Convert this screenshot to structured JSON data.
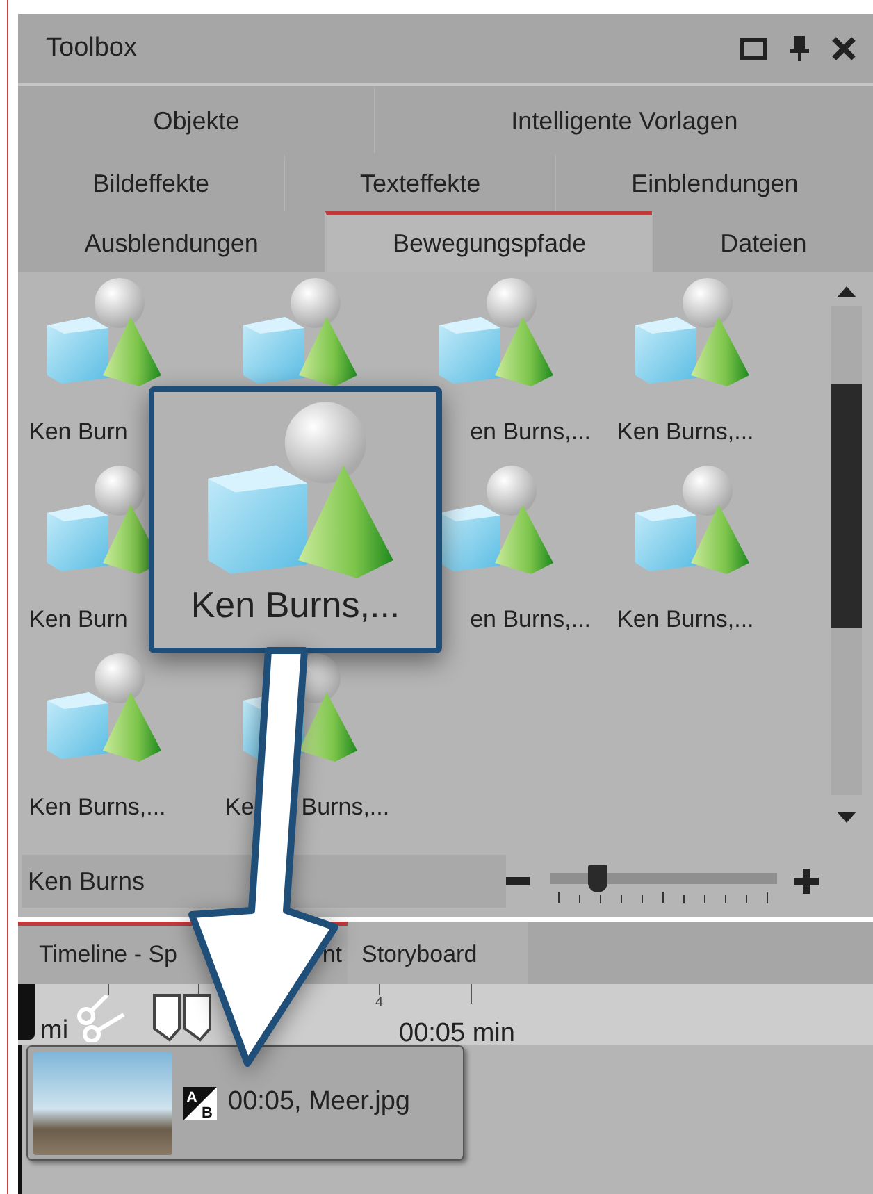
{
  "window": {
    "title": "Toolbox"
  },
  "tab_rows": [
    {
      "tabs": [
        {
          "label": "Objekte",
          "selected": false
        },
        {
          "label": "Intelligente Vorlagen",
          "selected": false
        }
      ]
    },
    {
      "tabs": [
        {
          "label": "Bildeffekte",
          "selected": false
        },
        {
          "label": "Texteffekte",
          "selected": false
        },
        {
          "label": "Einblendungen",
          "selected": false
        }
      ]
    },
    {
      "tabs": [
        {
          "label": "Ausblendungen",
          "selected": false
        },
        {
          "label": "Bewegungspfade",
          "selected": true
        },
        {
          "label": "Dateien",
          "selected": false
        }
      ]
    }
  ],
  "tiles": [
    {
      "kind": "plain",
      "label": "Ken Burn"
    },
    {
      "kind": "covered"
    },
    {
      "kind": "cut",
      "label": "en Burns,..."
    },
    {
      "kind": "plain",
      "label": "Ken Burns,..."
    },
    {
      "kind": "plain",
      "label": "Ken Burn"
    },
    {
      "kind": "covered"
    },
    {
      "kind": "cut",
      "label": "en Burns,..."
    },
    {
      "kind": "plain",
      "label": "Ken Burns,..."
    },
    {
      "kind": "plain",
      "label": "Ken Burns,..."
    },
    {
      "kind": "split",
      "label": "Ke",
      "label_after": "Burns,..."
    }
  ],
  "drag_preview": {
    "label": "Ken Burns,..."
  },
  "name_field": {
    "value": "Ken Burns"
  },
  "zoom_slider": {
    "level": 0.21
  },
  "bottom_tabs": [
    {
      "labels": [
        "Timeline - Sp",
        "nt"
      ],
      "selected": true
    },
    {
      "labels": [
        "Storyboard"
      ],
      "selected": false
    }
  ],
  "ruler": {
    "start_label": "mi",
    "tick_labels": [
      "4"
    ],
    "time": "00:05 min"
  },
  "clip": {
    "transition": {
      "top": "A",
      "bottom": "B"
    },
    "caption": "00:05, Meer.jpg"
  }
}
